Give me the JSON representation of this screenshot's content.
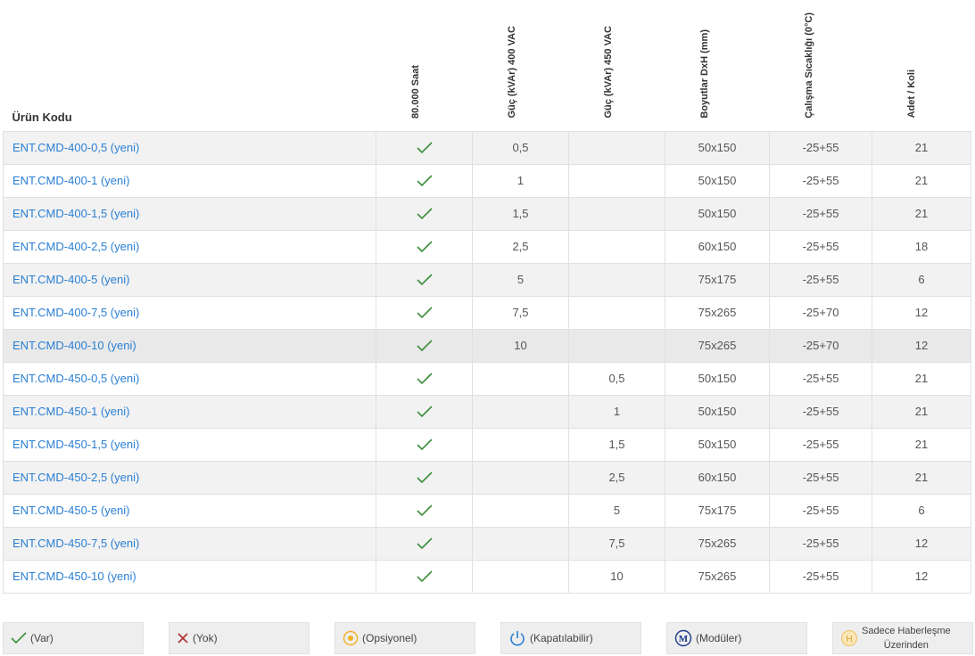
{
  "header": {
    "code": "Ürün Kodu",
    "col1": "80.000 Saat",
    "col2": "Güç (kVAr) 400 VAC",
    "col3": "Güç (kVAr) 450 VAC",
    "col4": "Boyutlar DxH (mm)",
    "col5": "Çalışma Sıcaklığı (0°C)",
    "col6": "Adet / Koli"
  },
  "rows": [
    {
      "code": "ENT.CMD-400-0,5 (yeni)",
      "p400": "0,5",
      "p450": "",
      "dim": "50x150",
      "temp": "-25+55",
      "qty": "21"
    },
    {
      "code": "ENT.CMD-400-1 (yeni)",
      "p400": "1",
      "p450": "",
      "dim": "50x150",
      "temp": "-25+55",
      "qty": "21"
    },
    {
      "code": "ENT.CMD-400-1,5 (yeni)",
      "p400": "1,5",
      "p450": "",
      "dim": "50x150",
      "temp": "-25+55",
      "qty": "21"
    },
    {
      "code": "ENT.CMD-400-2,5 (yeni)",
      "p400": "2,5",
      "p450": "",
      "dim": "60x150",
      "temp": "-25+55",
      "qty": "18"
    },
    {
      "code": "ENT.CMD-400-5 (yeni)",
      "p400": "5",
      "p450": "",
      "dim": "75x175",
      "temp": "-25+55",
      "qty": "6"
    },
    {
      "code": "ENT.CMD-400-7,5 (yeni)",
      "p400": "7,5",
      "p450": "",
      "dim": "75x265",
      "temp": "-25+70",
      "qty": "12"
    },
    {
      "code": "ENT.CMD-400-10 (yeni)",
      "p400": "10",
      "p450": "",
      "dim": "75x265",
      "temp": "-25+70",
      "qty": "12"
    },
    {
      "code": "ENT.CMD-450-0,5 (yeni)",
      "p400": "",
      "p450": "0,5",
      "dim": "50x150",
      "temp": "-25+55",
      "qty": "21"
    },
    {
      "code": "ENT.CMD-450-1 (yeni)",
      "p400": "",
      "p450": "1",
      "dim": "50x150",
      "temp": "-25+55",
      "qty": "21"
    },
    {
      "code": "ENT.CMD-450-1,5 (yeni)",
      "p400": "",
      "p450": "1,5",
      "dim": "50x150",
      "temp": "-25+55",
      "qty": "21"
    },
    {
      "code": "ENT.CMD-450-2,5 (yeni)",
      "p400": "",
      "p450": "2,5",
      "dim": "60x150",
      "temp": "-25+55",
      "qty": "21"
    },
    {
      "code": "ENT.CMD-450-5 (yeni)",
      "p400": "",
      "p450": "5",
      "dim": "75x175",
      "temp": "-25+55",
      "qty": "6"
    },
    {
      "code": "ENT.CMD-450-7,5 (yeni)",
      "p400": "",
      "p450": "7,5",
      "dim": "75x265",
      "temp": "-25+55",
      "qty": "12"
    },
    {
      "code": "ENT.CMD-450-10 (yeni)",
      "p400": "",
      "p450": "10",
      "dim": "75x265",
      "temp": "-25+55",
      "qty": "12"
    }
  ],
  "legend": {
    "var": "(Var)",
    "yok": "(Yok)",
    "opsiyonel": "(Opsiyonel)",
    "kapatilabilir": "(Kapatılabilir)",
    "moduler": "(Modüler)",
    "haberlesme_line1": "Sadece Haberleşme",
    "haberlesme_line2": "Üzerinden"
  },
  "colors": {
    "link": "#2a7fd4",
    "check": "#3c8f3c",
    "cross": "#b03030",
    "optional": "#f0b020",
    "power": "#2a7fd4",
    "modular": "#1a3a8a"
  },
  "icons": {
    "available": "check-icon",
    "not_available": "cross-icon",
    "optional": "optional-dot-icon",
    "switchable": "power-icon",
    "modular": "modular-m-icon",
    "comm_only": "h-circle-icon"
  }
}
